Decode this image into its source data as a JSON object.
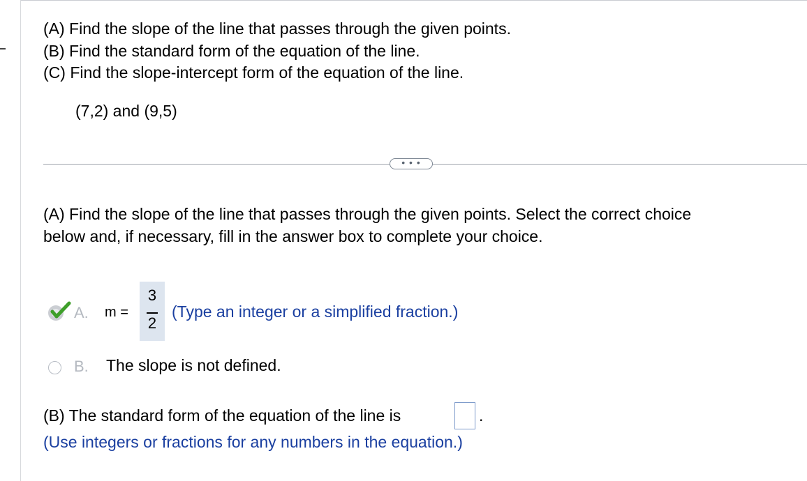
{
  "problem": {
    "lines": [
      "(A) Find the slope of the line that passes through the given points.",
      "(B) Find the standard form of the equation of the line.",
      "(C) Find the slope-intercept form of the equation of the line."
    ],
    "points": "(7,2) and (9,5)"
  },
  "more_button": {
    "label": "• • •"
  },
  "question_a": {
    "prompt_line1": "(A) Find the slope of the line that passes through the given points. Select the correct choice",
    "prompt_line2": "below and, if necessary, fill in the answer box to complete your choice."
  },
  "option_a": {
    "letter": "A.",
    "label": "m =",
    "numerator": "3",
    "denominator": "2",
    "hint": "(Type an integer or a simplified fraction.)",
    "status_icon": "correct-check-icon"
  },
  "option_b": {
    "letter": "B.",
    "text": "The slope is not defined."
  },
  "question_b": {
    "prompt": "(B) The standard form of the equation of the line is",
    "answer_value": "",
    "period": ".",
    "hint": "(Use integers or fractions for any numbers in the equation.)"
  },
  "colors": {
    "hint_text": "#1a3fa0",
    "check_green": "#3e9f2a",
    "answer_box_border": "#7b99c9",
    "fraction_bg": "#dde5ef"
  }
}
